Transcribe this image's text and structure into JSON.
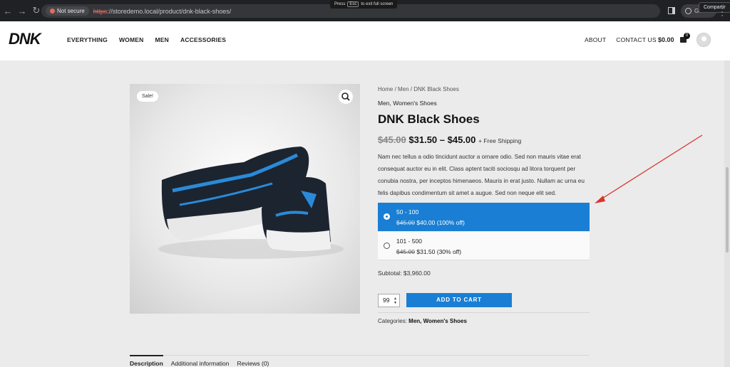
{
  "browser": {
    "security_label": "Not secure",
    "url_scheme": "https",
    "url_rest": "://storedemo.local/product/dnk-black-shoes/",
    "fullscreen_notice_pre": "Press",
    "fullscreen_notice_key": "Esc",
    "fullscreen_notice_post": "to exit full screen",
    "profile_label": "Guest",
    "share_tooltip": "Compartir"
  },
  "header": {
    "logo": "DNK",
    "main_nav": [
      "EVERYTHING",
      "WOMEN",
      "MEN",
      "ACCESSORIES"
    ],
    "secondary_nav": [
      "ABOUT",
      "CONTACT US"
    ],
    "cart_total": "$0.00",
    "cart_count": "0"
  },
  "product": {
    "sale_badge": "Sale!",
    "breadcrumb": "Home / Men / DNK Black Shoes",
    "categories_top": "Men, Women's Shoes",
    "title": "DNK Black Shoes",
    "price_old": "$45.00",
    "price_range": "$31.50 – $45.00",
    "shipping_note": "+ Free Shipping",
    "description": "Nam nec tellus a odio tincidunt auctor a ornare odio. Sed non mauris vitae erat consequat auctor eu in elit. Class aptent taciti sociosqu ad litora torquent per conubia nostra, per inceptos himenaeos. Mauris in erat justo. Nullam ac urna eu felis dapibus condimentum sit amet a augue. Sed non neque elit sed.",
    "tiers": [
      {
        "range": "50 - 100",
        "old": "$45.00",
        "price": "$40.00",
        "note": "(100% off)",
        "selected": true
      },
      {
        "range": "101 - 500",
        "old": "$45.00",
        "price": "$31.50",
        "note": "(30% off)",
        "selected": false
      }
    ],
    "subtotal": "Subtotal: $3,960.00",
    "quantity": "99",
    "add_to_cart": "ADD TO CART",
    "categories_label": "Categories:",
    "categories_value": "Men, Women's Shoes"
  },
  "tabs": [
    "Description",
    "Additional information",
    "Reviews (0)"
  ],
  "colors": {
    "accent": "#1a7fd4",
    "arrow": "#d9342b"
  }
}
